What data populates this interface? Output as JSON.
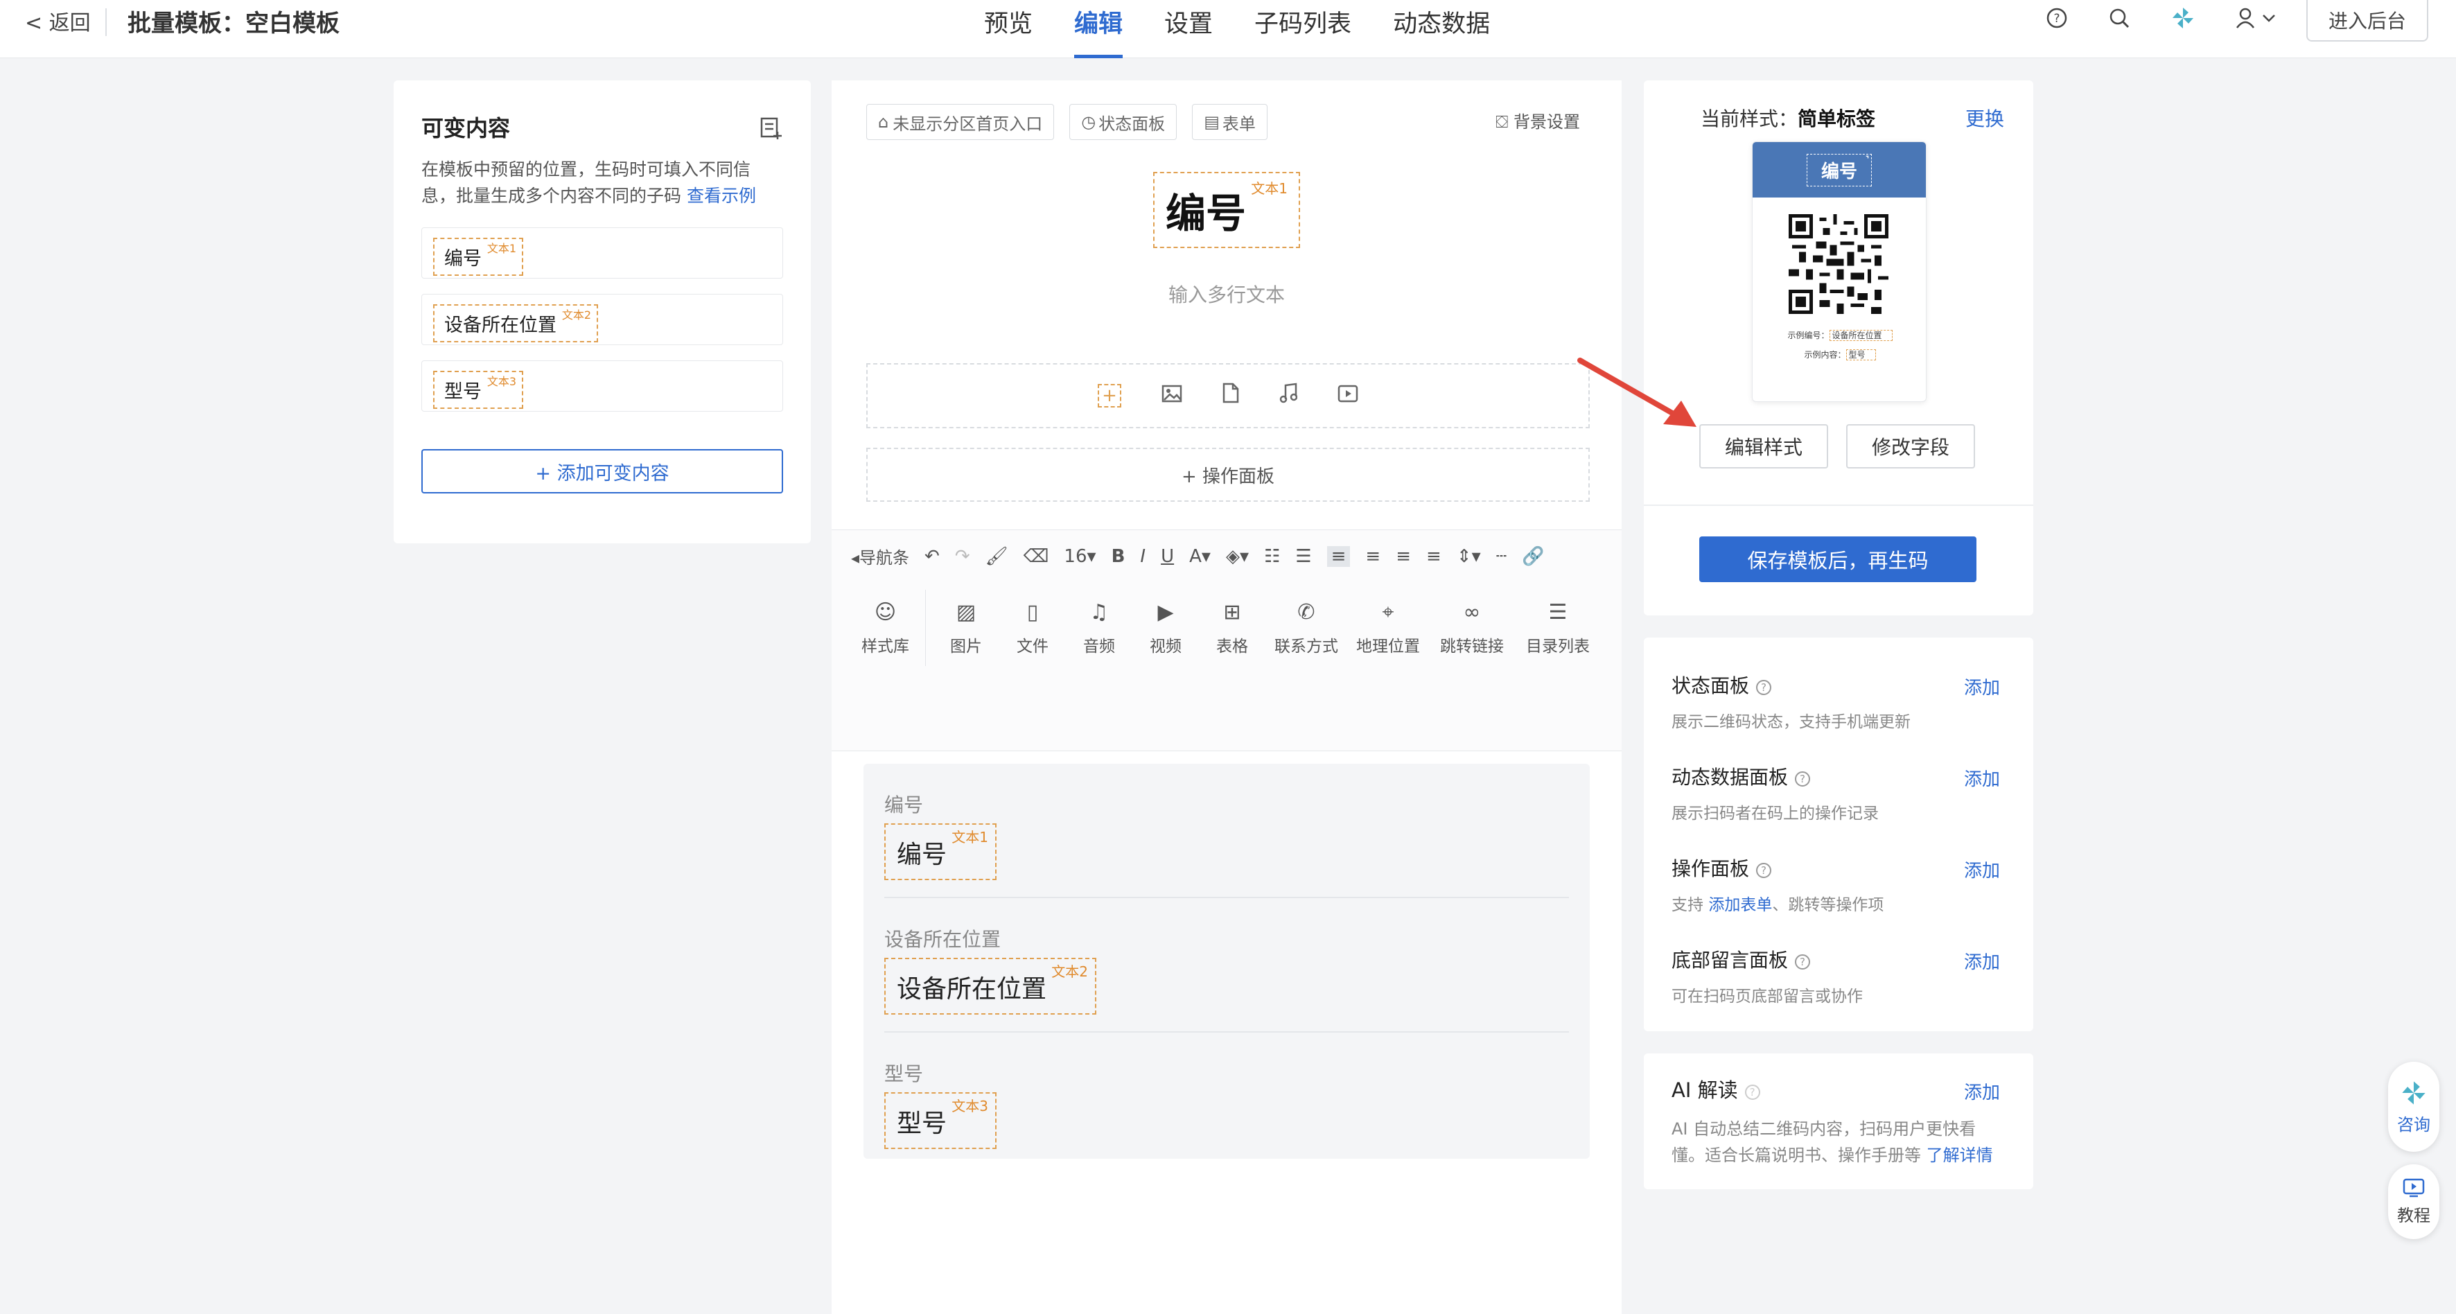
{
  "header": {
    "back_label": "< 返回",
    "title": "批量模板：空白模板",
    "tabs": [
      {
        "label": "预览"
      },
      {
        "label": "编辑"
      },
      {
        "label": "设置"
      },
      {
        "label": "子码列表"
      },
      {
        "label": "动态数据"
      }
    ],
    "active_tab": "编辑",
    "admin_button": "进入后台"
  },
  "left_panel": {
    "title": "可变内容",
    "description": "在模板中预留的位置，生码时可填入不同信息，批量生成多个内容不同的子码",
    "example_link": "查看示例",
    "variables": [
      {
        "label": "编号",
        "tag": "文本1"
      },
      {
        "label": "设备所在位置",
        "tag": "文本2"
      },
      {
        "label": "型号",
        "tag": "文本3"
      }
    ],
    "add_button": "+ 添加可变内容"
  },
  "editor": {
    "chips": [
      "未显示分区首页入口",
      "状态面板",
      "表单"
    ],
    "bg_setting": "背景设置",
    "title_text": "编号",
    "title_tag": "文本1",
    "multiline_placeholder": "输入多行文本",
    "op_panel": "+ 操作面板",
    "toolbar": {
      "nav": "导航条",
      "font_size": "16",
      "style_lib": "样式库",
      "tools": [
        "图片",
        "文件",
        "音频",
        "视频",
        "表格",
        "联系方式",
        "地理位置",
        "跳转链接",
        "目录列表"
      ]
    },
    "fields": [
      {
        "label": "编号",
        "value": "编号",
        "tag": "文本1"
      },
      {
        "label": "设备所在位置",
        "value": "设备所在位置",
        "tag": "文本2"
      },
      {
        "label": "型号",
        "value": "型号",
        "tag": "文本3"
      }
    ]
  },
  "right_panel": {
    "current_style_label": "当前样式：",
    "current_style_value": "简单标签",
    "change_link": "更换",
    "preview": {
      "head_tag": "编号",
      "line1_label": "示例编号：",
      "line1_value": "设备所在位置",
      "line2_label": "示例内容：",
      "line2_value": "型号"
    },
    "edit_style_button": "编辑样式",
    "edit_field_button": "修改字段",
    "save_button": "保存模板后，再生码",
    "panels": [
      {
        "title": "状态面板",
        "desc_prefix": "展示二维码状态，支持手机端更新",
        "desc_link": "",
        "desc_suffix": "",
        "add": "添加"
      },
      {
        "title": "动态数据面板",
        "desc_prefix": "展示扫码者在码上的操作记录",
        "desc_link": "",
        "desc_suffix": "",
        "add": "添加"
      },
      {
        "title": "操作面板",
        "desc_prefix": "支持 ",
        "desc_link": "添加表单",
        "desc_suffix": "、跳转等操作项",
        "add": "添加"
      },
      {
        "title": "底部留言面板",
        "desc_prefix": "可在扫码页底部留言或协作",
        "desc_link": "",
        "desc_suffix": "",
        "add": "添加"
      }
    ],
    "ai": {
      "title": "AI 解读",
      "add": "添加",
      "desc": "AI 自动总结二维码内容，扫码用户更快看懂。适合长篇说明书、操作手册等",
      "link": "了解详情"
    }
  },
  "floating": {
    "consult": "咨询",
    "tutorial": "教程"
  },
  "colors": {
    "accent": "#2f6bd0",
    "dashed_tag": "#e0a050",
    "arrow": "#e0463a"
  }
}
